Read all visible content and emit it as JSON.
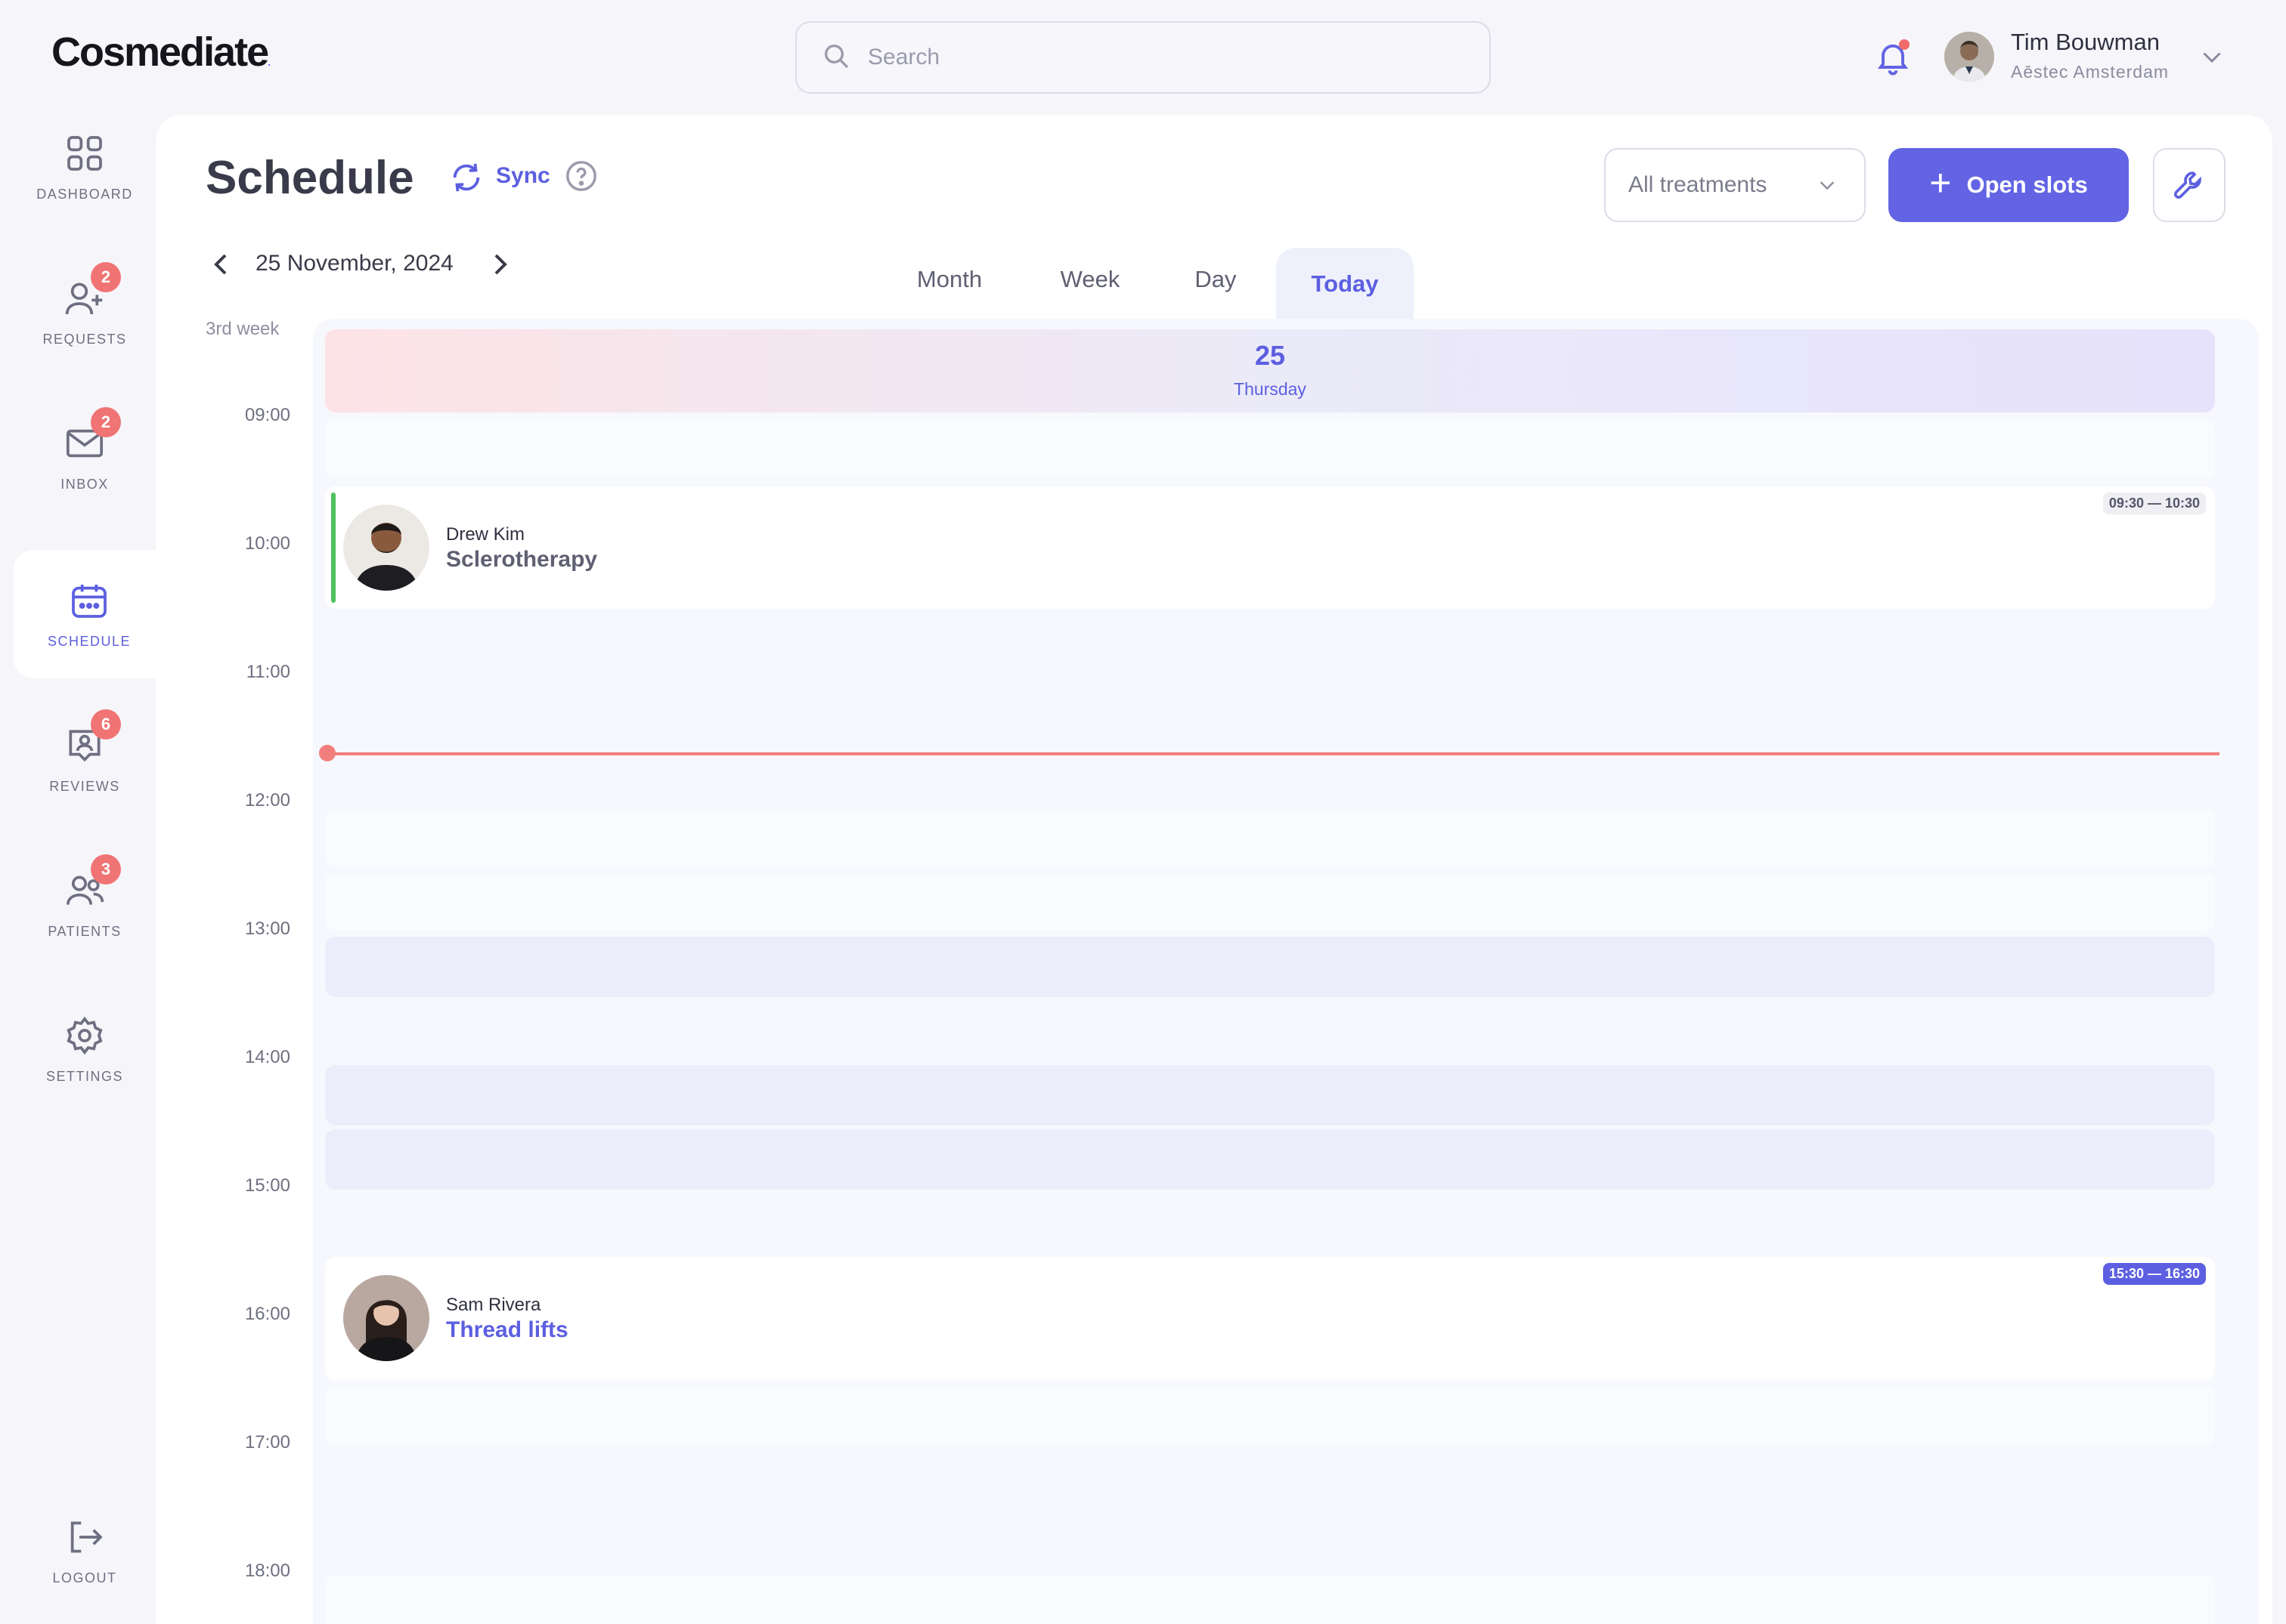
{
  "brand": {
    "logo_text": "Cosmediate",
    "logo_mark": "."
  },
  "search": {
    "placeholder": "Search",
    "value": ""
  },
  "user": {
    "name": "Tim Bouwman",
    "organization": "Aēstec Amsterdam"
  },
  "colors": {
    "accent": "#5c5fe0",
    "badge": "#f07474",
    "now_line": "#f27d7d",
    "confirmed": "#4fc05e"
  },
  "sidebar": {
    "items": [
      {
        "label": "DASHBOARD",
        "icon": "grid-icon",
        "badge": ""
      },
      {
        "label": "REQUESTS",
        "icon": "user-plus-icon",
        "badge": "2"
      },
      {
        "label": "INBOX",
        "icon": "mail-icon",
        "badge": "2"
      },
      {
        "label": "SCHEDULE",
        "icon": "calendar-icon",
        "badge": "",
        "active": true
      },
      {
        "label": "REVIEWS",
        "icon": "review-icon",
        "badge": "6"
      },
      {
        "label": "PATIENTS",
        "icon": "users-icon",
        "badge": "3"
      },
      {
        "label": "SETTINGS",
        "icon": "gear-icon",
        "badge": ""
      }
    ],
    "logout": "LOGOUT"
  },
  "main": {
    "title": "Schedule",
    "sync_label": "Sync",
    "filter_value": "All treatments",
    "open_slots_label": "Open slots",
    "current_date": "25 November, 2024",
    "tabs": [
      "Month",
      "Week",
      "Day",
      "Today"
    ],
    "active_tab": "Today",
    "week_label": "3rd week",
    "day": {
      "number": "25",
      "name": "Thursday"
    },
    "times": [
      "09:00",
      "10:00",
      "11:00",
      "12:00",
      "13:00",
      "14:00",
      "15:00",
      "16:00",
      "17:00",
      "18:00"
    ],
    "appointments": [
      {
        "patient": "Drew Kim",
        "treatment": "Sclerotherapy",
        "time": "09:30 — 10:30",
        "status": "confirmed"
      },
      {
        "patient": "Sam Rivera",
        "treatment": "Thread lifts",
        "time": "15:30 — 16:30",
        "status": "highlighted"
      }
    ]
  }
}
